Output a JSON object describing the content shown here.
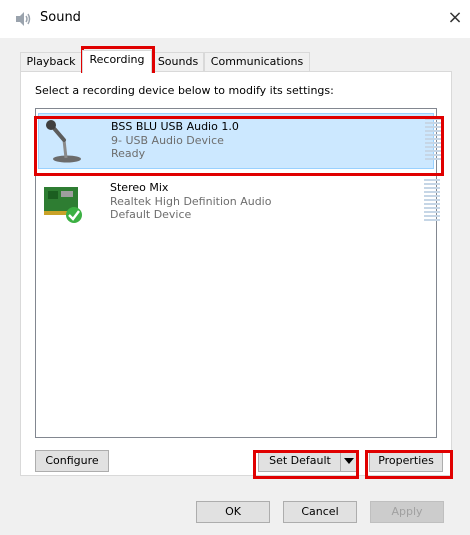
{
  "window": {
    "title": "Sound",
    "close_glyph": "×"
  },
  "tabs": [
    {
      "label": "Playback"
    },
    {
      "label": "Recording"
    },
    {
      "label": "Sounds"
    },
    {
      "label": "Communications"
    }
  ],
  "instruction": "Select a recording device below to modify its settings:",
  "devices": [
    {
      "name": "BSS BLU USB Audio 1.0",
      "description": "9- USB Audio Device",
      "status": "Ready",
      "icon": "microphone-icon",
      "selected": true
    },
    {
      "name": "Stereo Mix",
      "description": "Realtek High Definition Audio",
      "status": "Default Device",
      "icon": "sound-card-default-icon",
      "selected": false
    }
  ],
  "buttons": {
    "configure": "Configure",
    "set_default": "Set Default",
    "properties": "Properties",
    "ok": "OK",
    "cancel": "Cancel",
    "apply": "Apply"
  },
  "colors": {
    "highlight": "#e00000",
    "selection": "#cce8ff"
  }
}
